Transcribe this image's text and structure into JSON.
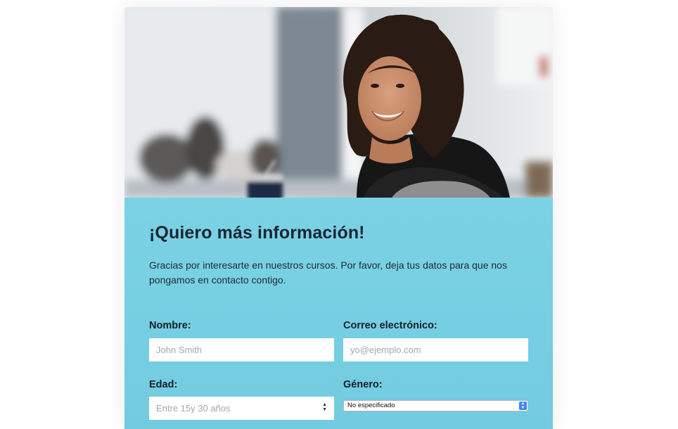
{
  "form": {
    "title": "¡Quiero más información!",
    "description": "Gracias por interesarte en nuestros cursos. Por favor, deja tus datos para que nos pongamos en contacto contigo.",
    "name_label": "Nombre:",
    "name_placeholder": "John Smith",
    "email_label": "Correo electrónico:",
    "email_placeholder": "yo@ejemplo.com",
    "age_label": "Edad:",
    "age_selected": "Entre 15y 30 años",
    "gender_label": "Género:",
    "gender_selected": "No especificado"
  },
  "colors": {
    "panel_background": "#79d1e3",
    "select_arrow_accent": "#3f86f5"
  },
  "icons": {
    "age_select_arrows": "chevron-up-down-icon",
    "gender_select_arrows": "chevron-up-down-icon"
  }
}
